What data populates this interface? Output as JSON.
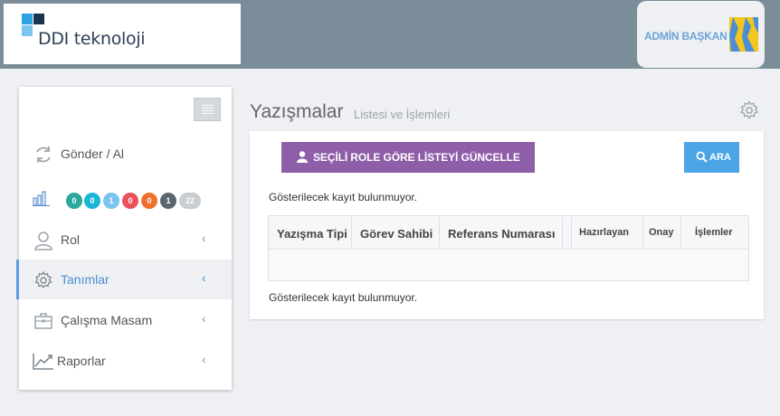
{
  "header": {
    "logo_text": "DDI teknoloji",
    "user_name": "ADMİN BAŞKAN"
  },
  "sidebar": {
    "items": [
      {
        "label": "Gönder / Al",
        "icon": "sync-icon"
      },
      {
        "label": "Rol",
        "icon": "user-icon"
      },
      {
        "label": "Tanımlar",
        "icon": "gear-icon",
        "active": true
      },
      {
        "label": "Çalışma Masam",
        "icon": "briefcase-icon"
      },
      {
        "label": "Raporlar",
        "icon": "chart-line-icon"
      }
    ],
    "stats_icon": "bar-chart-icon",
    "badges": [
      {
        "value": "0",
        "color": "#2aa89b"
      },
      {
        "value": "0",
        "color": "#1bb6d6"
      },
      {
        "value": "1",
        "color": "#7cc4f0"
      },
      {
        "value": "0",
        "color": "#e9525b"
      },
      {
        "value": "0",
        "color": "#ef6f2e"
      },
      {
        "value": "1",
        "color": "#5c6670"
      },
      {
        "value": "22",
        "color": "#c8cdd2"
      }
    ]
  },
  "main": {
    "title": "Yazışmalar",
    "subtitle": "Listesi ve İşlemleri",
    "update_button": "SEÇİLİ ROLE GÖRE LİSTEYİ GÜNCELLE",
    "search_button": "ARA",
    "empty_message_top": "Gösterilecek kayıt bulunmuyor.",
    "empty_message_bottom": "Gösterilecek kayıt bulunmuyor.",
    "table": {
      "columns": [
        "Yazışma Tipi",
        "Görev Sahibi",
        "Referans Numarası",
        "",
        "Hazırlayan",
        "Onay",
        "İşlemler"
      ]
    }
  },
  "colors": {
    "header_bg": "#7a8d98",
    "update_button": "#8e5ea9",
    "search_button": "#4aa4e6",
    "active_accent": "#5aa0e0"
  }
}
